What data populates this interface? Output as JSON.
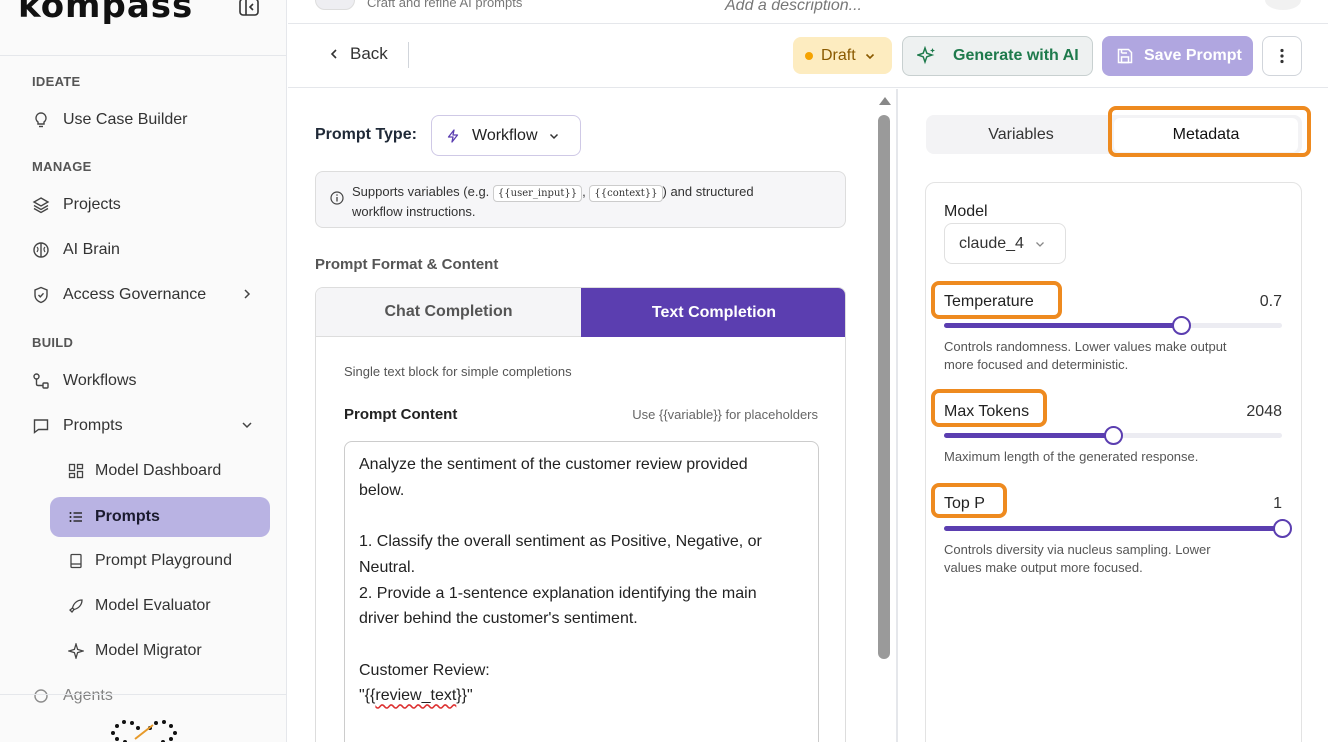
{
  "brand": {
    "logo_text": "kompass"
  },
  "sidebar": {
    "sections": {
      "ideate": "IDEATE",
      "manage": "MANAGE",
      "build": "BUILD"
    },
    "items": {
      "use_case_builder": "Use Case Builder",
      "projects": "Projects",
      "ai_brain": "AI Brain",
      "access_governance": "Access Governance",
      "workflows": "Workflows",
      "prompts": "Prompts",
      "agents": "Agents"
    },
    "sub_items": {
      "model_dashboard": "Model Dashboard",
      "prompts": "Prompts",
      "prompt_playground": "Prompt Playground",
      "model_evaluator": "Model Evaluator",
      "model_migrator": "Model Migrator"
    }
  },
  "header": {
    "subtitle": "Craft and refine AI prompts",
    "description_placeholder": "Add a description..."
  },
  "actionbar": {
    "back_label": "Back",
    "status_label": "Draft",
    "generate_label": "Generate with AI",
    "save_label": "Save Prompt"
  },
  "editor": {
    "prompt_type_label": "Prompt Type:",
    "prompt_type_value": "Workflow",
    "info_pre": "Supports variables (e.g.",
    "info_var1": "{{user_input}}",
    "info_comma": ",",
    "info_var2": "{{context}}",
    "info_post": ") and structured",
    "info_line2": "workflow instructions.",
    "format_label": "Prompt Format & Content",
    "tab_chat": "Chat Completion",
    "tab_text": "Text Completion",
    "single_text_desc": "Single text block for simple completions",
    "content_label": "Prompt Content",
    "content_hint": "Use {{variable}} for placeholders",
    "content_lines": [
      "Analyze the sentiment of the customer review provided",
      "below.",
      "",
      "1. Classify the overall sentiment as Positive, Negative, or",
      "Neutral.",
      "2. Provide a 1-sentence explanation identifying the main",
      "driver behind the customer's sentiment.",
      "",
      "Customer Review:"
    ],
    "content_last_open": "\"{{",
    "content_last_var": "review_text",
    "content_last_close": "}}\""
  },
  "right_panel": {
    "tab_variables": "Variables",
    "tab_metadata": "Metadata",
    "model_label": "Model",
    "model_value": "claude_4",
    "temperature": {
      "label": "Temperature",
      "value_text": "0.7",
      "fraction": 0.7,
      "help_line1": "Controls randomness. Lower values make output",
      "help_line2": "more focused and deterministic."
    },
    "max_tokens": {
      "label": "Max Tokens",
      "value_text": "2048",
      "fraction": 0.5,
      "help_line1": "Maximum length of the generated response."
    },
    "top_p": {
      "label": "Top P",
      "value_text": "1",
      "fraction": 1.0,
      "help_line1": "Controls diversity via nucleus sampling. Lower",
      "help_line2": "values make output more focused."
    }
  },
  "colors": {
    "accent": "#5b3eb0",
    "highlight": "#ee8a1f",
    "active_nav": "#b9b3e3",
    "draft_bg": "#fdecc0",
    "generate_text": "#1e7a4c"
  },
  "icons": [
    "collapse-sidebar-icon",
    "lightbulb-icon",
    "layers-icon",
    "brain-icon",
    "shield-icon",
    "workflow-icon",
    "message-icon",
    "grid-icon",
    "list-icon",
    "document-icon",
    "rocket-icon",
    "sparkle-icon",
    "bolt-icon",
    "info-icon",
    "save-icon",
    "kebab-icon"
  ]
}
